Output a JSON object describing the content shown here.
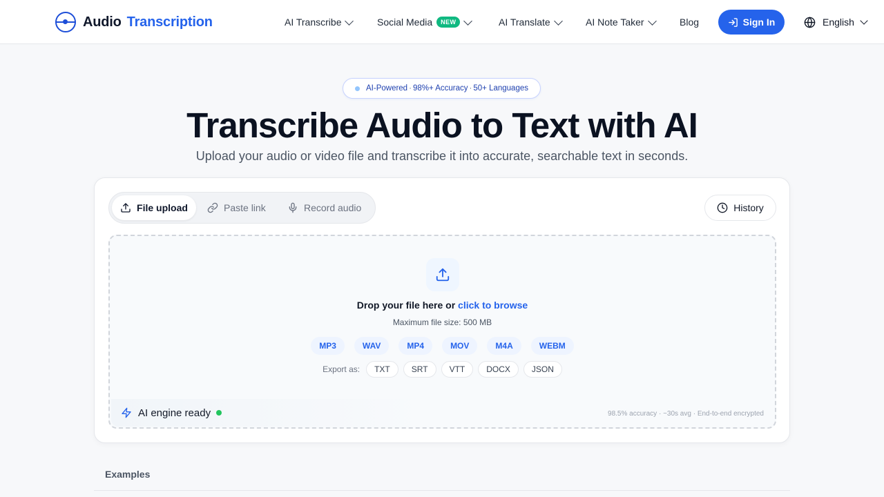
{
  "header": {
    "brand_first": "Audio",
    "brand_second": "Transcription",
    "nav": {
      "ai_transcribe": "AI Transcribe",
      "social_media": "Social Media",
      "new_badge": "NEW",
      "ai_translate": "AI Translate",
      "ai_note_taker": "AI Note Taker",
      "blog": "Blog"
    },
    "sign_in": "Sign In",
    "language": "English"
  },
  "hero": {
    "pill": {
      "part1": "AI-Powered",
      "part2": "98%+ Accuracy",
      "part3": "50+ Languages",
      "separator": "·"
    },
    "title": "Transcribe Audio to Text with AI",
    "subtitle": "Upload your audio or video file and transcribe it into accurate, searchable text in seconds."
  },
  "card": {
    "tabs": {
      "file_upload": "File upload",
      "paste_link": "Paste link",
      "record_audio": "Record audio"
    },
    "history": "History",
    "dropzone": {
      "drop_text": "Drop your file here or",
      "browse_text": "click to browse",
      "max_size": "Maximum file size: 500 MB",
      "formats": [
        "MP3",
        "WAV",
        "MP4",
        "MOV",
        "M4A",
        "WEBM"
      ],
      "export_label": "Export as:",
      "export_formats": [
        "TXT",
        "SRT",
        "VTT",
        "DOCX",
        "JSON"
      ]
    },
    "status": {
      "engine": "AI engine ready",
      "stats": "98.5% accuracy · ~30s avg · End-to-end encrypted"
    }
  },
  "examples_label": "Examples",
  "colors": {
    "accent": "#2563eb",
    "status_ok": "#22c55e",
    "badge_new": "#10b981"
  },
  "icons": {
    "logo": "circle-target-icon",
    "sign_in": "login-arrow-icon",
    "language": "globe-icon",
    "file_upload": "upload-icon",
    "paste_link": "link-icon",
    "record_audio": "microphone-icon",
    "history": "clock-icon",
    "dropzone": "upload-icon",
    "engine": "lightning-icon"
  }
}
